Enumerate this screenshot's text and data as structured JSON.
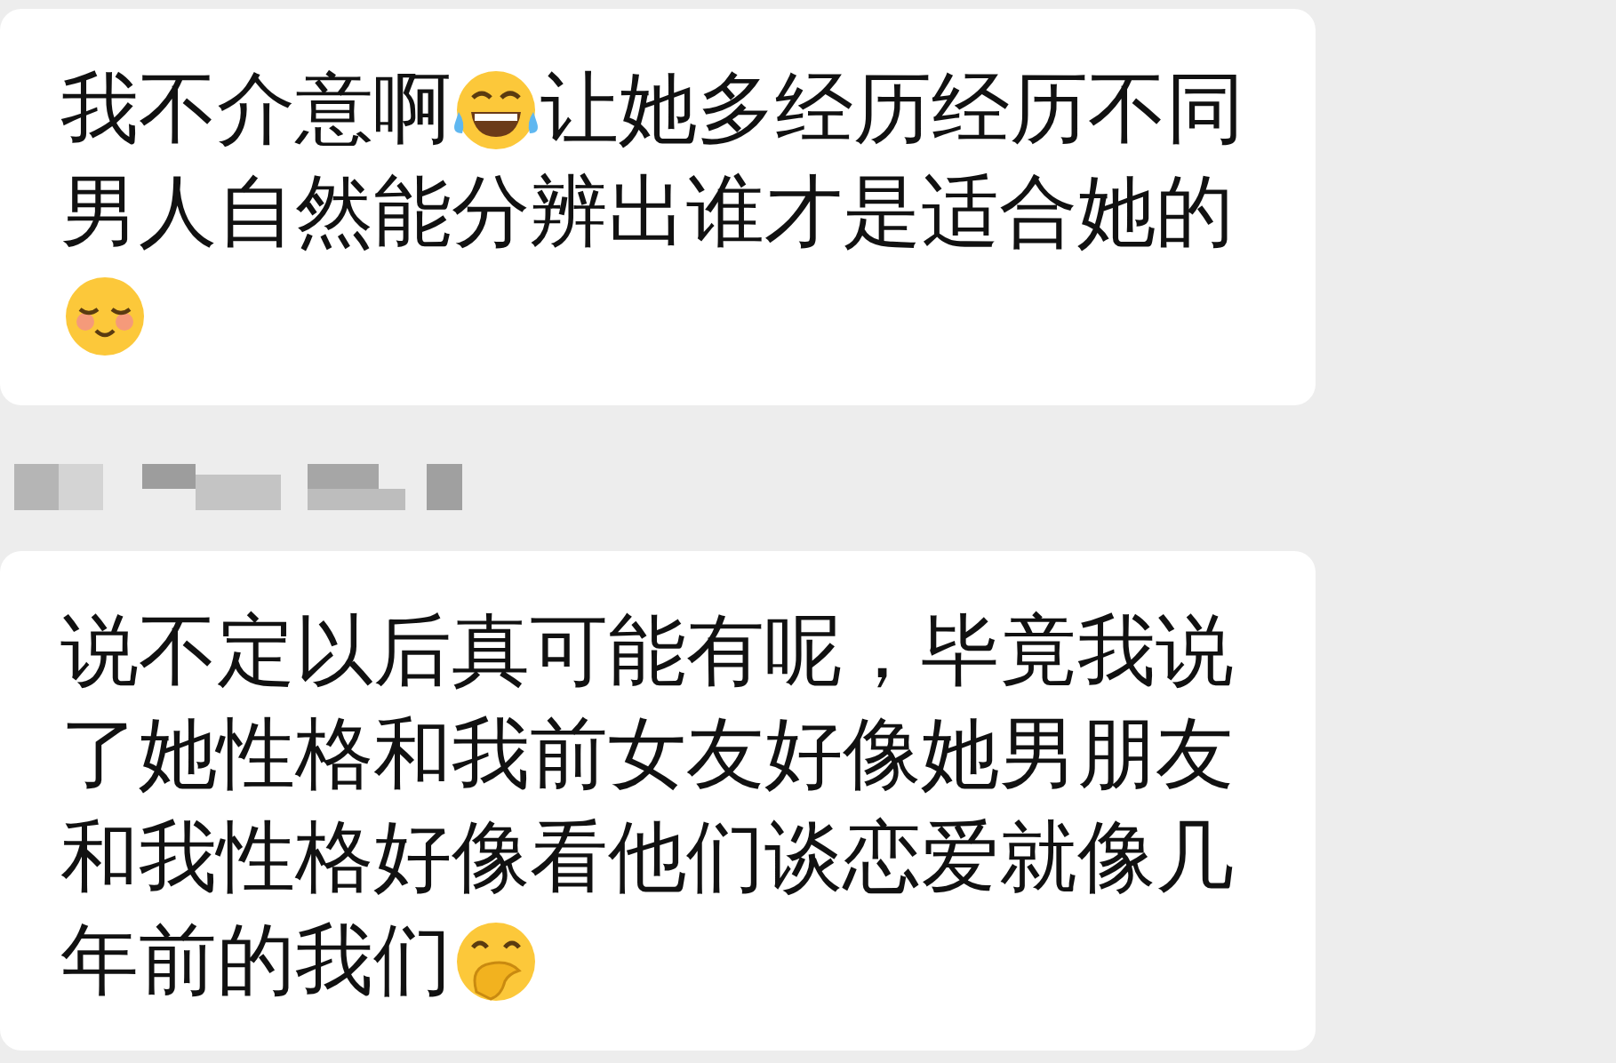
{
  "items": [
    {
      "kind": "bubble",
      "lines": [
        [
          {
            "kind": "text",
            "text": "我不介意啊"
          },
          {
            "kind": "laugh"
          },
          {
            "kind": "text",
            "text": "让她多经历经历不同"
          }
        ],
        [
          {
            "kind": "text",
            "text": "男人自然能分辨出谁才是适合她的"
          }
        ],
        [
          {
            "kind": "blush"
          }
        ]
      ]
    },
    {
      "kind": "redacted-name"
    },
    {
      "kind": "bubble",
      "lines": [
        [
          {
            "kind": "text",
            "text": "说不定以后真可能有呢，毕竟我说"
          }
        ],
        [
          {
            "kind": "text",
            "text": "了她性格和我前女友好像她男朋友"
          }
        ],
        [
          {
            "kind": "text",
            "text": "和我性格好像看他们谈恋爱就像几"
          }
        ],
        [
          {
            "kind": "text",
            "text": "年前的我们"
          },
          {
            "kind": "giggle"
          }
        ]
      ]
    }
  ]
}
